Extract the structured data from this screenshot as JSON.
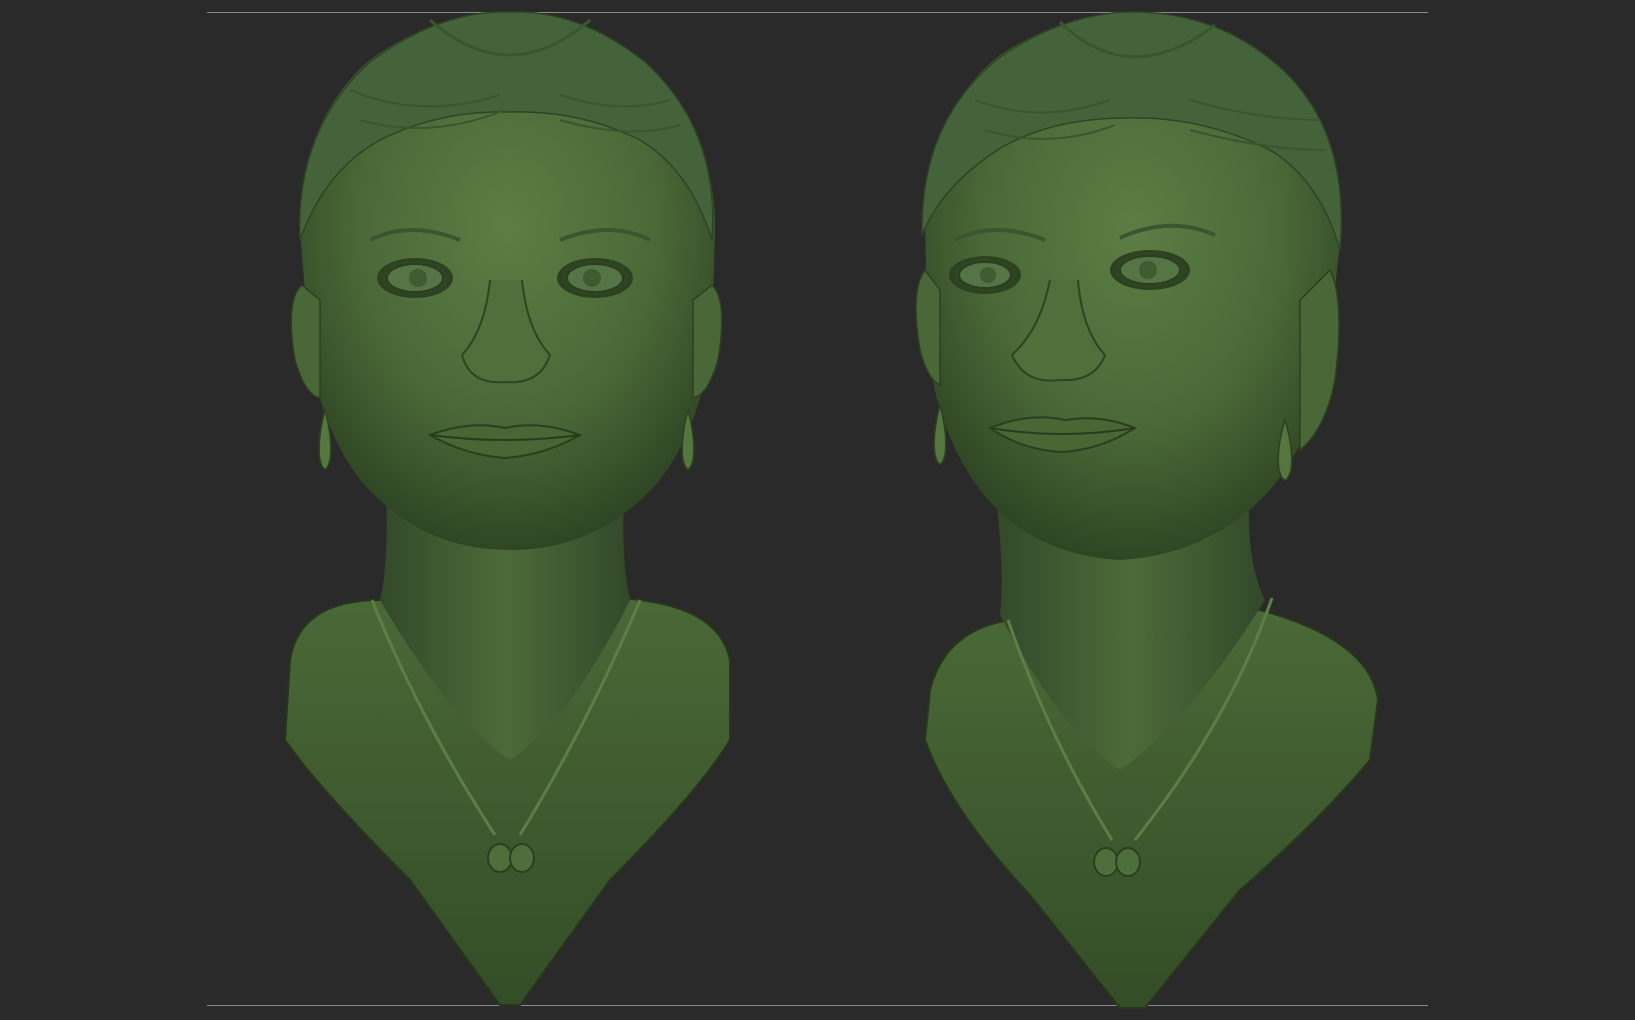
{
  "viewport": {
    "background": "#2a2a2a",
    "frame_line_color": "#8a8a8a"
  },
  "model": {
    "material_color": "#4b6a38",
    "material_shadow": "#2a3d1f",
    "material_highlight": "#5f8048"
  },
  "views": [
    {
      "name": "front-view"
    },
    {
      "name": "three-quarter-view"
    }
  ]
}
